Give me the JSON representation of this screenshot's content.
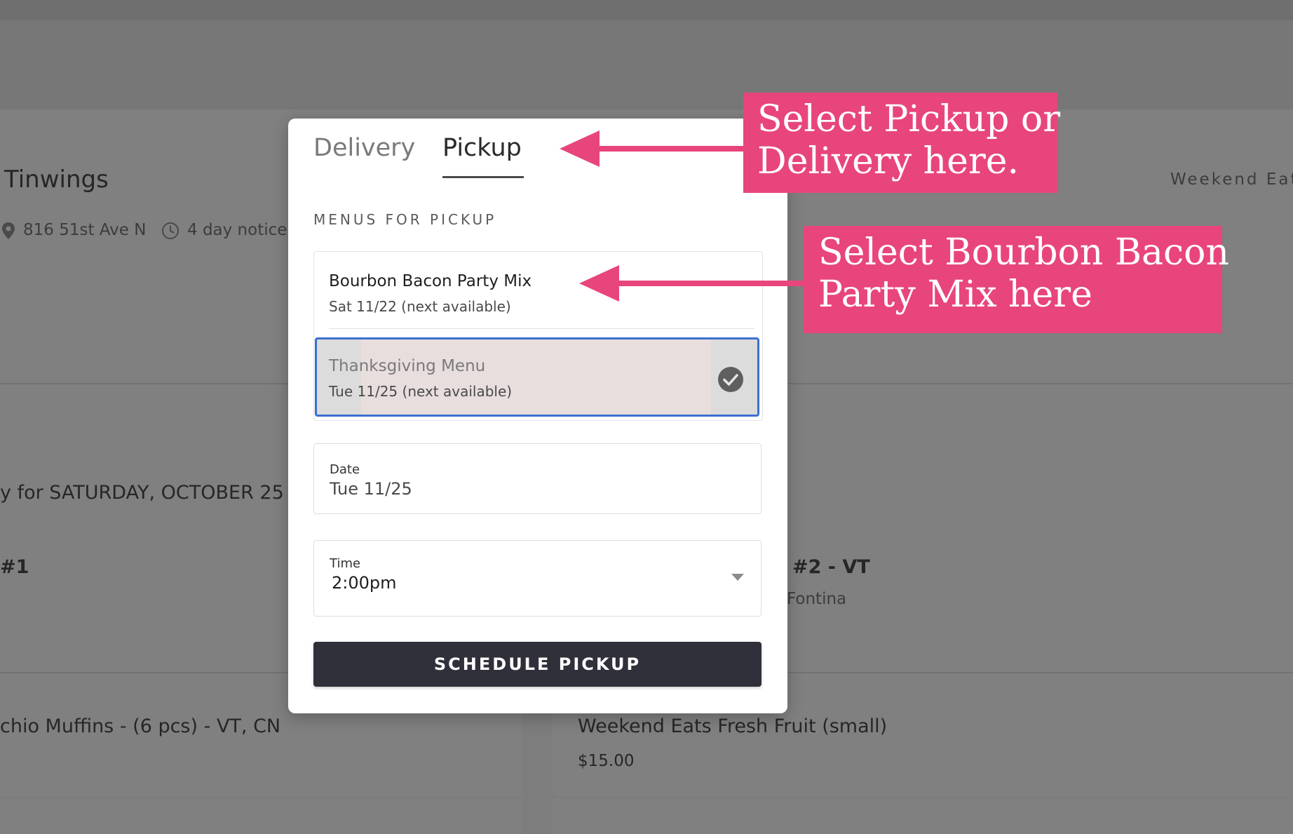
{
  "background": {
    "store_name": "Tinwings",
    "address": "816 51st Ave N",
    "notice": "4 day notice",
    "top_right_label": "Weekend Eat",
    "ordering_for": "y for SATURDAY, OCTOBER 25",
    "item_left_tag": "#1",
    "item_right_title": "#2 - VT",
    "item_right_sub": "Fontina",
    "product_left": "chio Muffins - (6 pcs) - VT, CN",
    "product_right": "Weekend Eats Fresh Fruit (small)",
    "product_right_price": "$15.00"
  },
  "modal": {
    "tabs": [
      {
        "label": "Delivery",
        "active": false
      },
      {
        "label": "Pickup",
        "active": true
      }
    ],
    "section_label": "MENUS FOR PICKUP",
    "menus": [
      {
        "name": "Bourbon Bacon Party Mix",
        "availability": "Sat 11/22 (next available)",
        "selected": false
      },
      {
        "name": "Thanksgiving Menu",
        "availability": "Tue 11/25 (next available)",
        "selected": true
      }
    ],
    "date": {
      "label": "Date",
      "value": "Tue 11/25"
    },
    "time": {
      "label": "Time",
      "value": "2:00pm"
    },
    "schedule_button": "SCHEDULE PICKUP"
  },
  "annotations": [
    {
      "line1": "Select Pickup or",
      "line2": "Delivery here."
    },
    {
      "line1": "Select Bourbon Bacon",
      "line2": "Party Mix here"
    }
  ],
  "colors": {
    "accent_pink": "#e8457d",
    "selected_border": "#3b6fd0",
    "button_dark": "#30303a"
  },
  "icons": [
    "location-pin-icon",
    "clock-icon",
    "checkmark-circle-icon",
    "chevron-down-icon",
    "arrow-left-icon"
  ]
}
